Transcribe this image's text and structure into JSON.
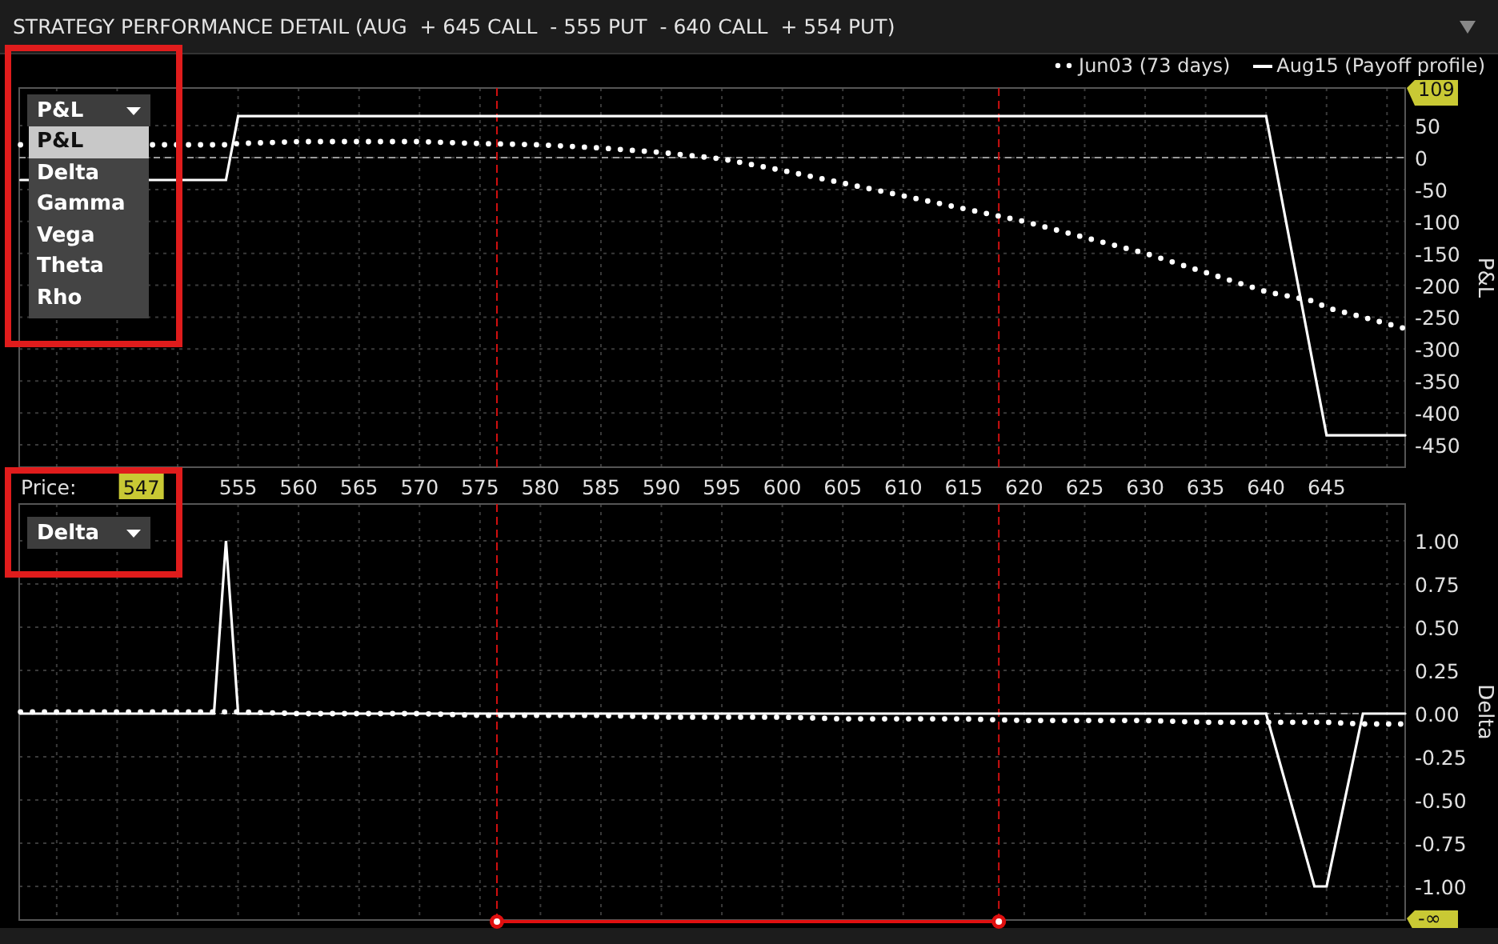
{
  "window": {
    "title": "STRATEGY PERFORMANCE DETAIL (AUG  + 645 CALL  - 555 PUT  - 640 CALL  + 554 PUT)"
  },
  "panels": [
    {
      "dropdown": {
        "value": "P&L",
        "expanded": true,
        "highlighted": true,
        "options": [
          {
            "label": "P&L",
            "selected": true
          },
          {
            "label": "Delta",
            "selected": false
          },
          {
            "label": "Gamma",
            "selected": false
          },
          {
            "label": "Vega",
            "selected": false
          },
          {
            "label": "Theta",
            "selected": false
          },
          {
            "label": "Rho",
            "selected": false
          }
        ]
      },
      "max_marker": "109",
      "price_label": "Price:",
      "price_marker": "547",
      "chart_data": {
        "type": "line",
        "ylabel": "P&L",
        "grid": true,
        "x": [
          537,
          550,
          553,
          554,
          555,
          560,
          565,
          570,
          575,
          580,
          585,
          590,
          595,
          600,
          605,
          610,
          615,
          620,
          625,
          630,
          635,
          640,
          644,
          645,
          648,
          651.5
        ],
        "series": [
          {
            "name": "Jun03 (73 days)",
            "line_style": "dotted",
            "color": "#ffffff",
            "values": [
              20,
              20,
              20,
              20,
              22,
              25,
              25,
              25,
              22,
              20,
              15,
              8,
              -2,
              -20,
              -40,
              -60,
              -80,
              -100,
              -125,
              -150,
              -180,
              -210,
              -225,
              -235,
              -250,
              -268
            ]
          },
          {
            "name": "Aug15 (Payoff profile)",
            "line_style": "solid",
            "color": "#ffffff",
            "values": [
              -35,
              -35,
              -35,
              -35,
              65,
              65,
              65,
              65,
              65,
              65,
              65,
              65,
              65,
              65,
              65,
              65,
              65,
              65,
              65,
              65,
              65,
              65,
              -335,
              -435,
              -435,
              -435
            ]
          }
        ],
        "xlim": [
          536.9,
          651.5
        ],
        "ylim": [
          -485,
          109
        ],
        "xticks": [
          555,
          560,
          565,
          570,
          575,
          580,
          585,
          590,
          595,
          600,
          605,
          610,
          615,
          620,
          625,
          630,
          635,
          640,
          645
        ],
        "yticks": [
          50,
          0,
          -50,
          -100,
          -150,
          -200,
          -250,
          -300,
          -350,
          -400,
          -450
        ],
        "ref_lines": [
          {
            "axis": "y",
            "value": 0
          },
          {
            "axis": "x",
            "value": 576.4
          },
          {
            "axis": "x",
            "value": 617.9
          }
        ]
      }
    },
    {
      "dropdown": {
        "value": "Delta",
        "expanded": false,
        "highlighted": true
      },
      "min_marker": "-∞",
      "chart_data": {
        "type": "line",
        "ylabel": "Delta",
        "grid": true,
        "x": [
          537,
          545,
          550,
          553,
          554,
          555,
          560,
          565,
          570,
          575,
          580,
          585,
          590,
          595,
          600,
          605,
          610,
          615,
          620,
          625,
          630,
          635,
          640,
          644,
          645,
          648,
          651.5
        ],
        "series": [
          {
            "line_style": "dotted",
            "color": "#ffffff",
            "values": [
              0.01,
              0.01,
              0.01,
              0.01,
              0.01,
              0.01,
              0,
              0,
              0,
              -0.01,
              -0.01,
              -0.01,
              -0.02,
              -0.02,
              -0.02,
              -0.03,
              -0.03,
              -0.03,
              -0.04,
              -0.04,
              -0.04,
              -0.05,
              -0.05,
              -0.05,
              -0.05,
              -0.06,
              -0.06
            ]
          },
          {
            "line_style": "solid",
            "color": "#ffffff",
            "values": [
              0,
              0,
              0,
              0,
              1,
              0,
              0,
              0,
              0,
              0,
              0,
              0,
              0,
              0,
              0,
              0,
              0,
              0,
              0,
              0,
              0,
              0,
              0,
              -1,
              -1,
              0,
              0
            ]
          }
        ],
        "xlim": [
          536.9,
          651.5
        ],
        "ylim": [
          -1.194,
          1.213
        ],
        "yticks": [
          {
            "value": 1,
            "label": "1.00"
          },
          {
            "value": 0.75,
            "label": "0.75"
          },
          {
            "value": 0.5,
            "label": "0.50"
          },
          {
            "value": 0.25,
            "label": "0.25"
          },
          {
            "value": 0,
            "label": "0.00"
          },
          {
            "value": -0.25,
            "label": "-0.25"
          },
          {
            "value": -0.5,
            "label": "-0.50"
          },
          {
            "value": -0.75,
            "label": "-0.75"
          },
          {
            "value": -1,
            "label": "-1.00"
          }
        ],
        "ref_lines": [
          {
            "axis": "y",
            "value": 0
          },
          {
            "axis": "x",
            "value": 576.4
          },
          {
            "axis": "x",
            "value": 617.9
          }
        ]
      }
    }
  ]
}
